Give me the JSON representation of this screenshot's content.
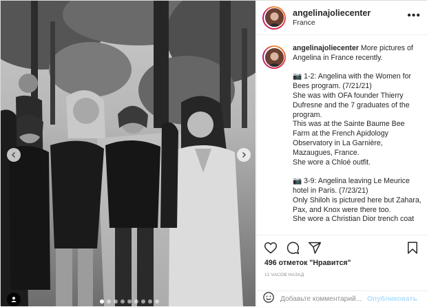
{
  "post": {
    "username": "angelinajoliecenter",
    "location": "France",
    "caption": {
      "username": "angelinajoliecenter",
      "intro": "More pictures of Angelina in France recently.",
      "section1": [
        "📷 1-2: Angelina with the Women for Bees program. (7/21/21)",
        "She was with OFA founder Thierry Dufresne and the 7 graduates of the program.",
        "This was at the Sainte Baume Bee Farm at the French Apidology Observatory in La Garnière, Mazaugues, France.",
        "She wore a Chloé outfit."
      ],
      "section2": [
        "📷 3-9: Angelina leaving Le Meurice hotel in Paris. (7/23/21)",
        "Only Shiloh is pictured here but Zahara, Pax, and Knox were there too.",
        "She wore a Christian Dior trench coat"
      ]
    },
    "likes": "496 отметок \"Нравится\"",
    "timestamp": "11 часов назад",
    "comment_placeholder": "Добавьте комментарий...",
    "publish_label": "Опубликовать"
  },
  "carousel": {
    "slides": 9,
    "active_index": 0
  },
  "icons": {
    "more": "more-options-icon",
    "like": "heart-icon",
    "comment": "comment-icon",
    "share": "share-icon",
    "save": "bookmark-icon",
    "emoji": "smiley-icon",
    "tags": "user-tag-icon",
    "prev": "chevron-left-icon",
    "next": "chevron-right-icon"
  }
}
